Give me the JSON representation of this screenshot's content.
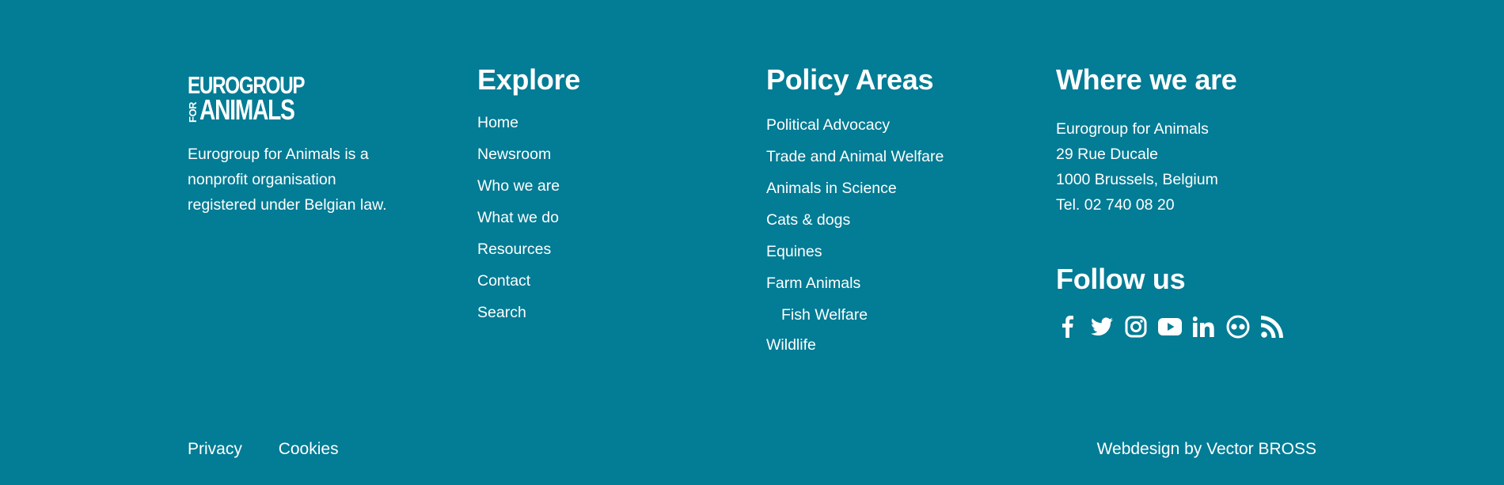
{
  "brand": {
    "logo_line1": "EUROGROUP",
    "logo_for": "FOR",
    "logo_line2": "ANIMALS",
    "description": "Eurogroup for Animals is a nonprofit organisation registered under Belgian law."
  },
  "explore": {
    "title": "Explore",
    "links": [
      "Home",
      "Newsroom",
      "Who we are",
      "What we do",
      "Resources",
      "Contact",
      "Search"
    ]
  },
  "policy": {
    "title": "Policy Areas",
    "links": [
      {
        "label": "Political Advocacy",
        "sub": false
      },
      {
        "label": "Trade and Animal Welfare",
        "sub": false
      },
      {
        "label": "Animals in Science",
        "sub": false
      },
      {
        "label": "Cats & dogs",
        "sub": false
      },
      {
        "label": "Equines",
        "sub": false
      },
      {
        "label": "Farm Animals",
        "sub": false
      },
      {
        "label": "Fish Welfare",
        "sub": true
      },
      {
        "label": "Wildlife",
        "sub": false
      }
    ]
  },
  "where": {
    "title": "Where we are",
    "address": [
      "Eurogroup for Animals",
      "29 Rue Ducale",
      "1000 Brussels, Belgium",
      "Tel. 02 740 08 20"
    ]
  },
  "follow": {
    "title": "Follow us",
    "icons": [
      "facebook-icon",
      "twitter-icon",
      "instagram-icon",
      "youtube-icon",
      "linkedin-icon",
      "flickr-icon",
      "rss-icon"
    ]
  },
  "bottom": {
    "privacy": "Privacy",
    "cookies": "Cookies",
    "credit": "Webdesign by Vector BROSS"
  },
  "colors": {
    "background": "#037c95",
    "text": "#ffffff"
  }
}
